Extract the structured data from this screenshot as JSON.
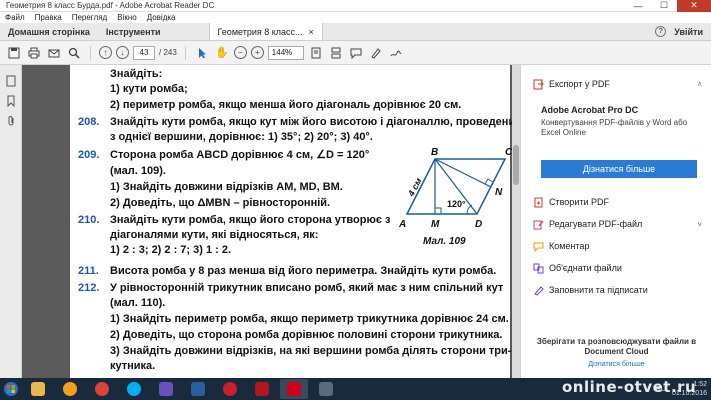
{
  "window": {
    "title": "Геометрия 8 класс Бурда.pdf - Adobe Acrobat Reader DC",
    "min": "—",
    "max": "☐",
    "close": "✕"
  },
  "menu": [
    "Файл",
    "Правка",
    "Перегляд",
    "Вікно",
    "Довідка"
  ],
  "tabs": {
    "home": "Домашня сторінка",
    "tools": "Інструменти",
    "doc": "Геометрия 8 класс...",
    "doc_close": "×",
    "help": "?",
    "signin": "Увійти"
  },
  "toolbar": {
    "page_current": "43",
    "page_total": "/ 243",
    "zoom": "144%"
  },
  "document": {
    "lines": {
      "l0": "Знайдіть:",
      "l1": "1) кути ромба;",
      "l2": "2) периметр ромба, якщо менша його діагональ дорівнює 20 см.",
      "n208": "208.",
      "t208a": "Знайдіть кути ромба, якщо кут між його висотою і діагоналлю, проведеними",
      "t208b": "з однієї вершини, дорівнює:   1) 35°;   2) 20°;   3) 40°.",
      "n209": "209.",
      "t209a": "Сторона ромба ABCD дорівнює 4 см, ∠D = 120°",
      "t209b": "(мал. 109).",
      "t209c": "1) Знайдіть довжини відрізків AM, MD, BM.",
      "t209d": "2) Доведіть, що ΔMBN – рівносторонній.",
      "n210": "210.",
      "t210a": "Знайдіть кути ромба, якщо його сторона утворює з",
      "t210b": "діагоналями кути, які відносяться, як:",
      "t210c": "1) 2 : 3;   2) 2 : 7;   3) 1 : 2.",
      "n211": "211.",
      "t211": "Висота ромба у 8 раз менша від його периметра. Знайдіть кути ромба.",
      "n212": "212.",
      "t212a": "У рівносторонній трикутник вписано ромб, який має з ним спільний кут",
      "t212b": "(мал. 110).",
      "t212c": "1) Знайдіть периметр ромба, якщо периметр трикутника дорівнює 24 см.",
      "t212d": "2) Доведіть, що сторона ромба дорівнює половині сторони трикутника.",
      "t212e": "3) Знайдіть довжини відрізків, на які вершини ромба ділять сторони три-",
      "t212f": "кутника."
    },
    "figure": {
      "B": "B",
      "C": "C",
      "N": "N",
      "A": "A",
      "M": "M",
      "D": "D",
      "side": "4 см",
      "angle": "120°",
      "caption": "Мал. 109"
    }
  },
  "right_panel": {
    "export_pdf": "Експорт у PDF",
    "promo_title": "Adobe Acrobat Pro DC",
    "promo_text": "Конвертування PDF-файлів у Word або Excel Online",
    "promo_button": "Дізнатися більше",
    "items": [
      "Створити PDF",
      "Редагувати PDF-файл",
      "Коментар",
      "Об'єднати файли",
      "Заповнити та підписати"
    ],
    "footer_text": "Зберігати та розповсюджувати файли в Document Cloud",
    "footer_link": "Дізнатися більше"
  },
  "taskbar": {
    "lang": "RU",
    "time": "1:52",
    "date": "01.10.2016"
  },
  "watermark": "online-otvet.ru",
  "colors": {
    "accent": "#2b7bd4",
    "problem_number": "#1f54a6",
    "taskbar": "#1a2a3d"
  }
}
